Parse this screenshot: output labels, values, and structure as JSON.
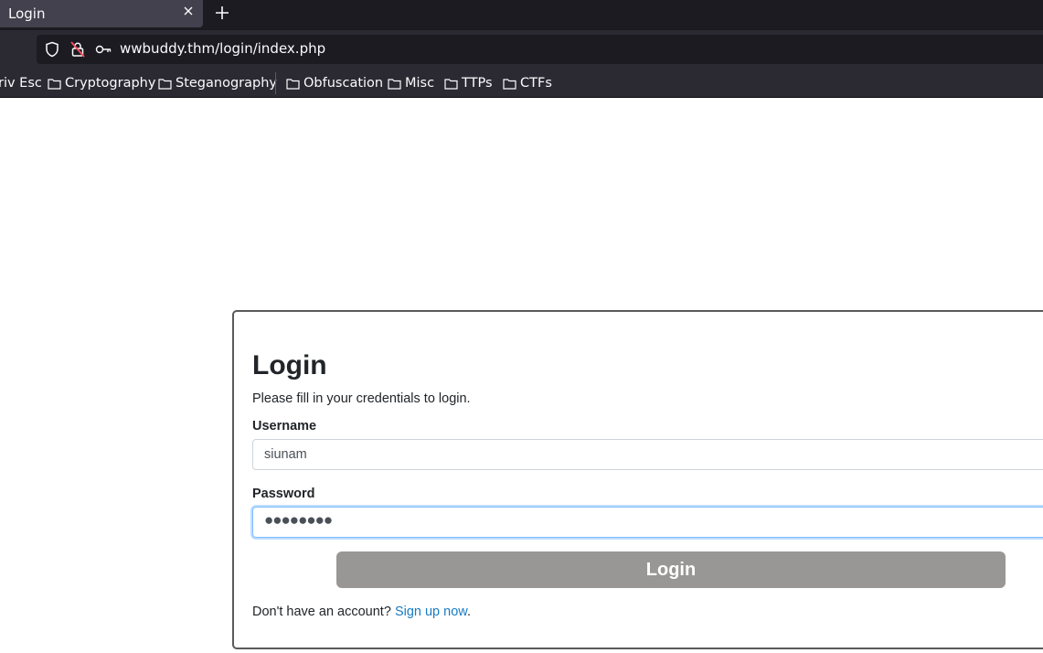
{
  "browser": {
    "tab_title": "Login",
    "url": "wwbuddy.thm/login/index.php",
    "bookmarks": [
      "riv Esc",
      "Cryptography",
      "Steganography",
      "Obfuscation",
      "Misc",
      "TTPs",
      "CTFs"
    ]
  },
  "login": {
    "title": "Login",
    "subtitle": "Please fill in your credentials to login.",
    "username_label": "Username",
    "username_value": "siunam",
    "password_label": "Password",
    "password_masked": "●●●●●●●●",
    "submit_label": "Login",
    "footer_prefix": "Don't have an account?",
    "signup_link": "Sign up now",
    "footer_suffix": "."
  }
}
